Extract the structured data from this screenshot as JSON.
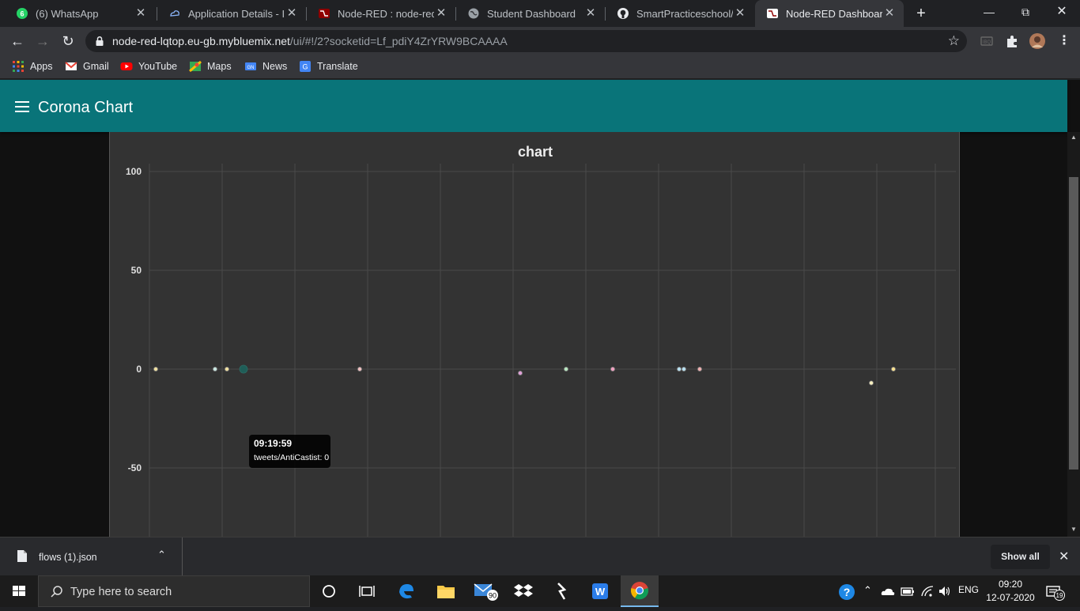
{
  "browser": {
    "tabs": [
      {
        "title": "(6) WhatsApp",
        "icon": "whatsapp-icon"
      },
      {
        "title": "Application Details - IBM",
        "icon": "ibm-cloud-icon"
      },
      {
        "title": "Node-RED : node-red-lqtop",
        "icon": "node-red-icon"
      },
      {
        "title": "Student Dashboard",
        "icon": "globe-icon"
      },
      {
        "title": "SmartPracticeschool/SB",
        "icon": "github-icon"
      },
      {
        "title": "Node-RED Dashboard",
        "icon": "node-red-icon",
        "active": true
      }
    ],
    "url_host": "node-red-lqtop.eu-gb.mybluemix.net",
    "url_rest": "/ui/#!/2?socketid=Lf_pdiY4ZrYRW9BCAAAA",
    "bookmarks": [
      "Apps",
      "Gmail",
      "YouTube",
      "Maps",
      "News",
      "Translate"
    ]
  },
  "dashboard": {
    "title": "Corona Chart",
    "accent_color": "#097479"
  },
  "chart_data": {
    "type": "scatter",
    "title": "chart",
    "ylim": [
      -75,
      100
    ],
    "yticks": [
      100,
      50,
      0,
      -50
    ],
    "grid": true,
    "points": [
      {
        "x": 1,
        "y": 0,
        "color": "#f0e0a0"
      },
      {
        "x": 2,
        "y": 0,
        "color": "#c8e6e0"
      },
      {
        "x": 3,
        "y": 0,
        "color": "#f0e0a0"
      },
      {
        "x": 4,
        "y": 0,
        "color": "#1f5e58",
        "highlight": true
      },
      {
        "x": 5,
        "y": 0,
        "color": "#f0c0c0"
      },
      {
        "x": 6,
        "y": -2,
        "color": "#e0a0d8"
      },
      {
        "x": 7,
        "y": 0,
        "color": "#b8e8c0"
      },
      {
        "x": 8,
        "y": 0,
        "color": "#f0a0c0"
      },
      {
        "x": 9,
        "y": 0,
        "color": "#b8e0f0"
      },
      {
        "x": 10,
        "y": 0,
        "color": "#b8e0f0"
      },
      {
        "x": 11,
        "y": 0,
        "color": "#f0b0b0"
      },
      {
        "x": 12,
        "y": -7,
        "color": "#f8f0c0"
      },
      {
        "x": 13,
        "y": 0,
        "color": "#f8e090"
      }
    ],
    "tooltip": {
      "time": "09:19:59",
      "text": "tweets/AntiCastist: 0"
    }
  },
  "download": {
    "filename": "flows (1).json",
    "show_all": "Show all"
  },
  "taskbar": {
    "search_placeholder": "Type here to search",
    "mail_badge": "90",
    "language": "ENG",
    "time": "09:20",
    "date": "12-07-2020",
    "notifications": "19"
  }
}
